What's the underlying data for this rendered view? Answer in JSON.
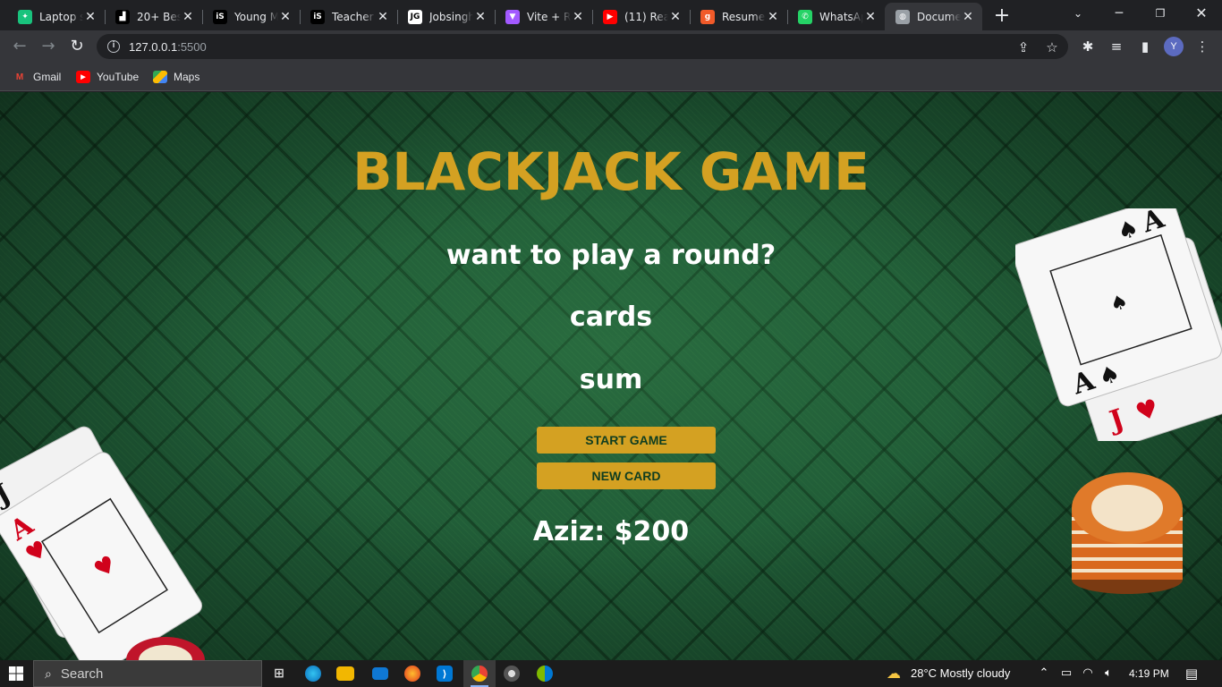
{
  "browser": {
    "tabs": [
      {
        "title": "Laptop s",
        "icon": "chatgpt-icon",
        "color": "#19c37d"
      },
      {
        "title": "20+ Best",
        "icon": "site-icon",
        "color": "#000000"
      },
      {
        "title": "Young M",
        "icon": "is-icon",
        "color": "#000000"
      },
      {
        "title": "Teacher",
        "icon": "is-icon",
        "color": "#000000"
      },
      {
        "title": "Jobsingh",
        "icon": "jg-icon",
        "color": "#ffffff"
      },
      {
        "title": "Vite + Re",
        "icon": "vite-icon",
        "color": "#a259ff"
      },
      {
        "title": "(11) Rea",
        "icon": "youtube-icon",
        "color": "#ff0000"
      },
      {
        "title": "Resume",
        "icon": "g-icon",
        "color": "#f15a29"
      },
      {
        "title": "WhatsAp",
        "icon": "whatsapp-icon",
        "color": "#25d366"
      },
      {
        "title": "Docume",
        "icon": "globe-icon",
        "color": "#9aa0a6"
      }
    ],
    "active_tab_index": 9,
    "url_host": "127.0.0.1",
    "url_port": ":5500",
    "profile_initial": "Y",
    "bookmarks": [
      {
        "label": "Gmail",
        "icon": "gmail-icon"
      },
      {
        "label": "YouTube",
        "icon": "youtube-icon"
      },
      {
        "label": "Maps",
        "icon": "maps-icon"
      }
    ]
  },
  "game": {
    "title": "BLACKJACK GAME",
    "message": "want to play a round?",
    "cards_label": "cards",
    "sum_label": "sum",
    "start_button": "START GAME",
    "new_card_button": "NEW CARD",
    "player": "Aziz: $200"
  },
  "taskbar": {
    "search_placeholder": "Search",
    "weather": "28°C  Mostly cloudy",
    "time": "4:19 PM"
  },
  "colors": {
    "accent": "#d4a122",
    "felt": "#1f5a36"
  }
}
